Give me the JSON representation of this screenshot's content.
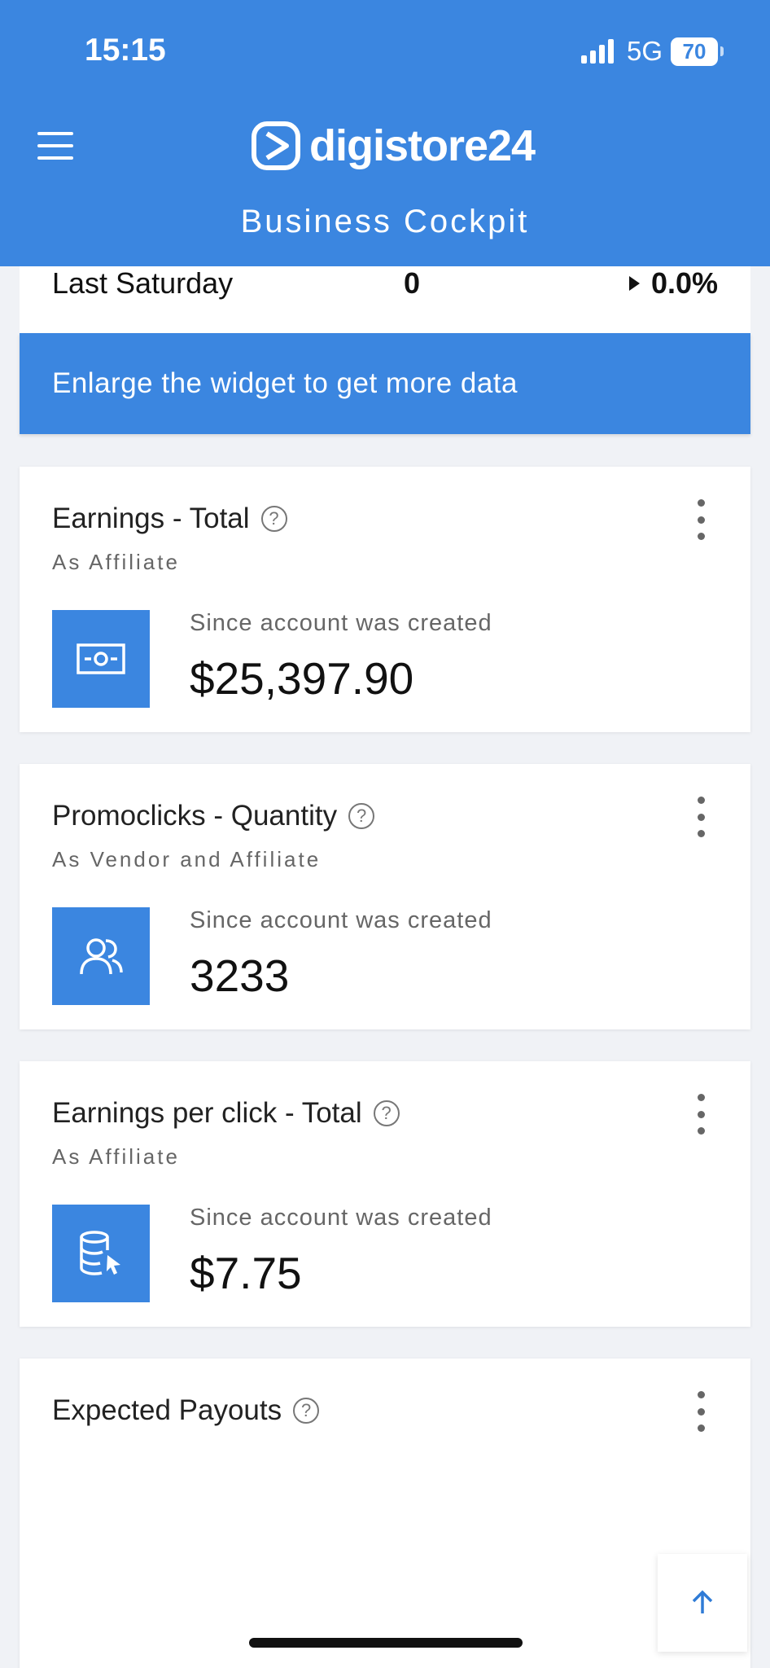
{
  "status_bar": {
    "time": "15:15",
    "network": "5G",
    "battery": "70"
  },
  "header": {
    "logo": "digistore24",
    "subtitle": "Business Cockpit"
  },
  "top_widget": {
    "label": "Last Saturday",
    "value": "0",
    "change": "0.0%"
  },
  "enlarge_banner": "Enlarge the widget to get more data",
  "cards": [
    {
      "title": "Earnings - Total",
      "subtitle": "As Affiliate",
      "period": "Since account was created",
      "value": "$25,397.90",
      "icon": "money-icon"
    },
    {
      "title": "Promoclicks - Quantity",
      "subtitle": "As Vendor and Affiliate",
      "period": "Since account was created",
      "value": "3233",
      "icon": "users-icon"
    },
    {
      "title": "Earnings per click - Total",
      "subtitle": "As Affiliate",
      "period": "Since account was created",
      "value": "$7.75",
      "icon": "database-click-icon"
    },
    {
      "title": "Expected Payouts"
    }
  ],
  "help_glyph": "?"
}
